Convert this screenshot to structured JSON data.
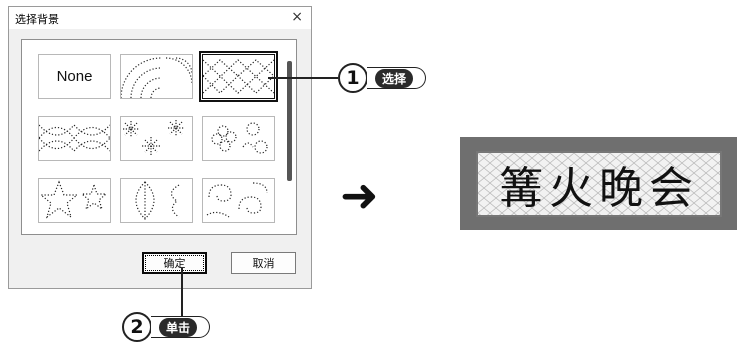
{
  "dialog": {
    "title": "选择背景",
    "close_glyph": "×",
    "tiles": [
      {
        "id": "none",
        "label": "None"
      },
      {
        "id": "arcs",
        "label": ""
      },
      {
        "id": "diamonds",
        "label": "",
        "selected": true
      },
      {
        "id": "wavy-diamonds",
        "label": ""
      },
      {
        "id": "snowflakes",
        "label": ""
      },
      {
        "id": "flowers",
        "label": ""
      },
      {
        "id": "stars",
        "label": ""
      },
      {
        "id": "leaves",
        "label": ""
      },
      {
        "id": "swirls",
        "label": ""
      }
    ],
    "ok_label": "确定",
    "cancel_label": "取消"
  },
  "callouts": {
    "step1_number": "1",
    "step1_label": "选择",
    "step2_number": "2",
    "step2_label": "单击"
  },
  "arrow_glyph": "➜",
  "preview": {
    "text": "篝火晚会"
  }
}
